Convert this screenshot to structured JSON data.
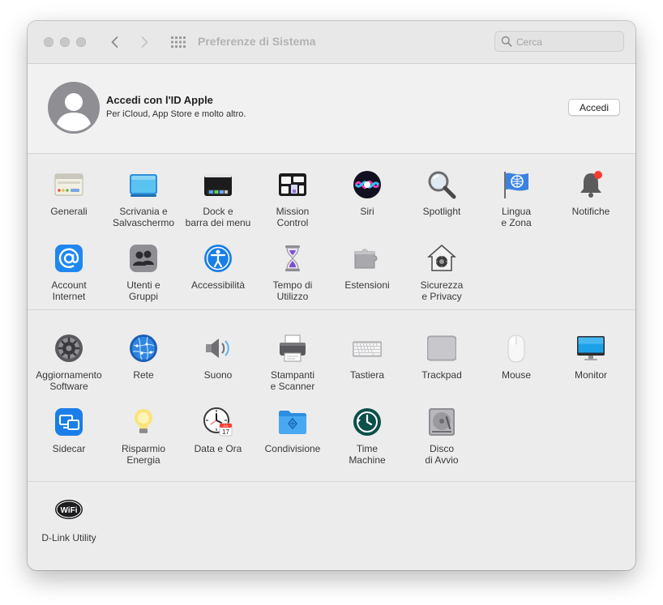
{
  "window": {
    "title": "Preferenze di Sistema",
    "search_placeholder": "Cerca"
  },
  "account": {
    "title": "Accedi con l'ID Apple",
    "subtitle": "Per iCloud, App Store e molto altro.",
    "button_label": "Accedi"
  },
  "row1": [
    {
      "label1": "Generali",
      "label2": "",
      "icon": "general-icon"
    },
    {
      "label1": "Scrivania e",
      "label2": "Salvaschermo",
      "icon": "desktop-screensaver-icon"
    },
    {
      "label1": "Dock e",
      "label2": "barra dei menu",
      "icon": "dock-menubar-icon"
    },
    {
      "label1": "Mission",
      "label2": "Control",
      "icon": "mission-control-icon"
    },
    {
      "label1": "Siri",
      "label2": "",
      "icon": "siri-icon"
    },
    {
      "label1": "Spotlight",
      "label2": "",
      "icon": "spotlight-icon"
    },
    {
      "label1": "Lingua",
      "label2": "e Zona",
      "icon": "language-region-icon"
    },
    {
      "label1": "Notifiche",
      "label2": "",
      "icon": "notifications-icon"
    }
  ],
  "row2": [
    {
      "label1": "Account",
      "label2": "Internet",
      "icon": "internet-accounts-icon"
    },
    {
      "label1": "Utenti e",
      "label2": "Gruppi",
      "icon": "users-groups-icon"
    },
    {
      "label1": "Accessibilità",
      "label2": "",
      "icon": "accessibility-icon"
    },
    {
      "label1": "Tempo di",
      "label2": "Utilizzo",
      "icon": "screen-time-icon"
    },
    {
      "label1": "Estensioni",
      "label2": "",
      "icon": "extensions-icon"
    },
    {
      "label1": "Sicurezza",
      "label2": "e Privacy",
      "icon": "security-privacy-icon"
    }
  ],
  "row3": [
    {
      "label1": "Aggiornamento",
      "label2": "Software",
      "icon": "software-update-icon"
    },
    {
      "label1": "Rete",
      "label2": "",
      "icon": "network-icon"
    },
    {
      "label1": "Suono",
      "label2": "",
      "icon": "sound-icon"
    },
    {
      "label1": "Stampanti",
      "label2": "e Scanner",
      "icon": "printers-scanners-icon"
    },
    {
      "label1": "Tastiera",
      "label2": "",
      "icon": "keyboard-icon"
    },
    {
      "label1": "Trackpad",
      "label2": "",
      "icon": "trackpad-icon"
    },
    {
      "label1": "Mouse",
      "label2": "",
      "icon": "mouse-icon"
    },
    {
      "label1": "Monitor",
      "label2": "",
      "icon": "displays-icon"
    }
  ],
  "row4": [
    {
      "label1": "Sidecar",
      "label2": "",
      "icon": "sidecar-icon"
    },
    {
      "label1": "Risparmio",
      "label2": "Energia",
      "icon": "energy-saver-icon"
    },
    {
      "label1": "Data e Ora",
      "label2": "",
      "icon": "date-time-icon",
      "calendar_day": "17",
      "calendar_month": "JUL"
    },
    {
      "label1": "Condivisione",
      "label2": "",
      "icon": "sharing-icon"
    },
    {
      "label1": "Time",
      "label2": "Machine",
      "icon": "time-machine-icon"
    },
    {
      "label1": "Disco",
      "label2": "di Avvio",
      "icon": "startup-disk-icon"
    }
  ],
  "row5": [
    {
      "label1": "D-Link Utility",
      "label2": "",
      "icon": "dlink-wifi-icon",
      "badge_text": "WiFi"
    }
  ]
}
